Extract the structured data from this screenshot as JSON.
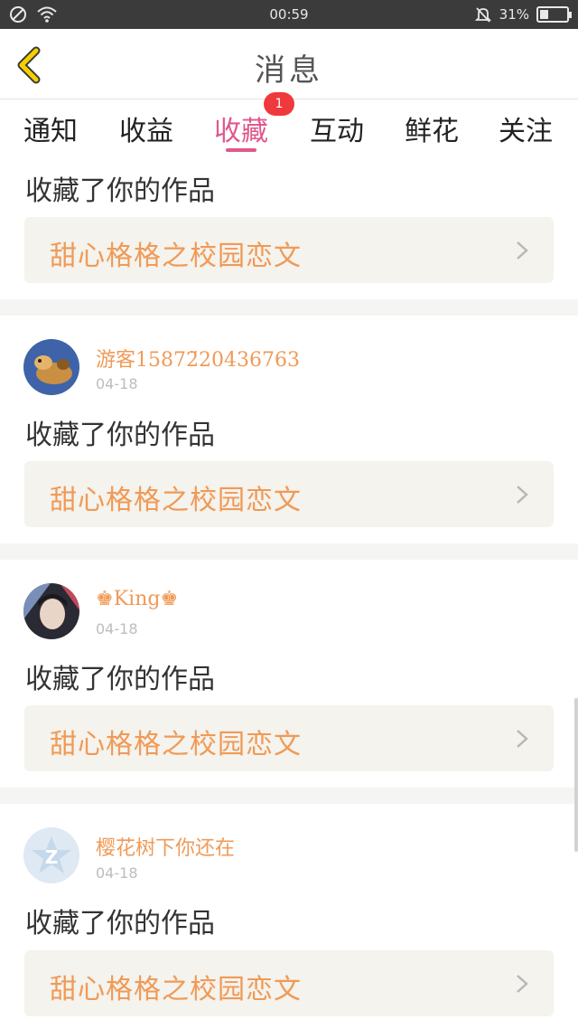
{
  "status_bar": {
    "time": "00:59",
    "battery": "31%"
  },
  "header": {
    "title": "消息"
  },
  "tabs": [
    {
      "label": "通知"
    },
    {
      "label": "收益"
    },
    {
      "label": "收藏",
      "active": true,
      "badge": "1"
    },
    {
      "label": "互动"
    },
    {
      "label": "鲜花"
    },
    {
      "label": "关注"
    }
  ],
  "messages": [
    {
      "action": "收藏了你的作品",
      "work": "甜心格格之校园恋文"
    },
    {
      "user": "游客15872̈20436763",
      "date": "04-18",
      "action": "收藏了你的作品",
      "work": "甜心格格之校园恋文"
    },
    {
      "user": "♚King♚",
      "date": "04-18",
      "action": "收藏了你的作品",
      "work": "甜心格格之校园恋文"
    },
    {
      "user": "樱花树下你还在",
      "date": "04-18",
      "action": "收藏了你的作品",
      "work": "甜心格格之校园恋文"
    }
  ],
  "colors": {
    "accent": "#e0578c",
    "link": "#f09a57",
    "badge": "#f0393c",
    "back": "#f5d000"
  }
}
